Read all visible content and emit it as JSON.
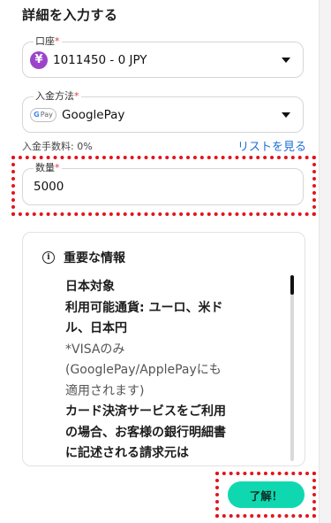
{
  "page": {
    "title": "詳細を入力する"
  },
  "account": {
    "label": "口座",
    "required_mark": "*",
    "value": "1011450 - 0 JPY",
    "icon": "yen-icon"
  },
  "deposit_method": {
    "label": "入金方法",
    "required_mark": "*",
    "value": "GooglePay",
    "icon": "gpay-icon"
  },
  "fee": {
    "text": "入金手数料: 0%"
  },
  "list_link": {
    "label": "リストを見る"
  },
  "amount": {
    "label": "数量",
    "required_mark": "*",
    "value": "5000"
  },
  "info": {
    "title": "重要な情報",
    "lines": [
      "日本対象",
      "利用可能通貨: ユーロ、米ド",
      "ル、日本円",
      "*VISAのみ",
      "(GooglePay/ApplePayにも",
      "適用されます)",
      "カード決済サービスをご利用",
      "の場合、お客様の銀行明細書",
      "に記述される請求元は"
    ]
  },
  "ok_button": {
    "label": "了解！"
  },
  "colors": {
    "accent_button": "#0fd8b0",
    "link": "#1e6fd9",
    "required": "#e3344b",
    "highlight_border": "#e3141b",
    "yen_icon": "#9b44c9"
  }
}
